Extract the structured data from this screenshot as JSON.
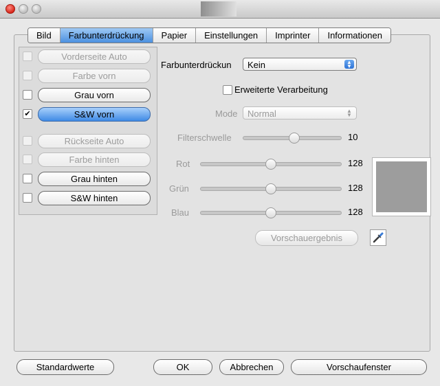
{
  "window": {
    "title": ""
  },
  "tabs": [
    "Bild",
    "Farbunterdrückung",
    "Papier",
    "Einstellungen",
    "Imprinter",
    "Informationen"
  ],
  "active_tab": "Farbunterdrückung",
  "options": [
    {
      "label": "Vorderseite Auto",
      "checked": false,
      "enabled": false
    },
    {
      "label": "Farbe vorn",
      "checked": false,
      "enabled": false
    },
    {
      "label": "Grau vorn",
      "checked": false,
      "enabled": true
    },
    {
      "label": "S&W vorn",
      "checked": true,
      "enabled": true,
      "selected": true
    },
    {
      "label": "Rückseite Auto",
      "checked": false,
      "enabled": false
    },
    {
      "label": "Farbe hinten",
      "checked": false,
      "enabled": false
    },
    {
      "label": "Grau hinten",
      "checked": false,
      "enabled": true
    },
    {
      "label": "S&W hinten",
      "checked": false,
      "enabled": true
    }
  ],
  "dropout": {
    "label": "Farbunterdrückun",
    "value": "Kein"
  },
  "advanced": {
    "label": "Erweiterte Verarbeitung",
    "checked": false
  },
  "mode": {
    "label": "Mode",
    "value": "Normal"
  },
  "threshold": {
    "label": "Filterschwelle",
    "value": "10"
  },
  "rot": {
    "label": "Rot",
    "value": "128"
  },
  "gruen": {
    "label": "Grün",
    "value": "128"
  },
  "blau": {
    "label": "Blau",
    "value": "128"
  },
  "preview_button": "Vorschauergebnis",
  "preview_color": "#9d9d9d",
  "buttons": {
    "defaults": "Standardwerte",
    "ok": "OK",
    "cancel": "Abbrechen",
    "preview_window": "Vorschaufenster"
  }
}
